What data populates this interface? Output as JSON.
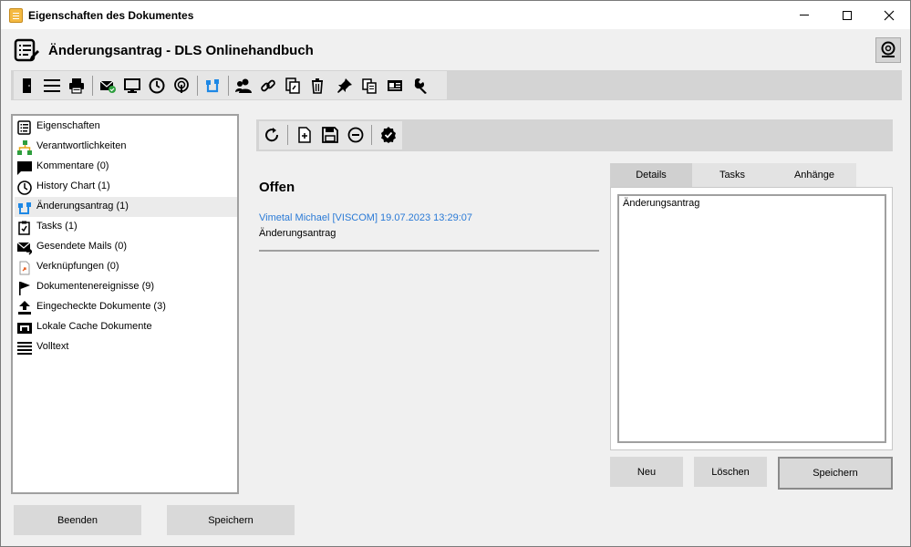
{
  "window": {
    "title": "Eigenschaften des Dokumentes"
  },
  "header": {
    "title": "Änderungsantrag - DLS Onlinehandbuch"
  },
  "main_toolbar": {
    "icons": [
      "door-icon",
      "menu-icon",
      "print-icon",
      "mail-check-icon",
      "monitor-icon",
      "clock-icon",
      "broadcast-icon",
      "workflow-icon",
      "users-icon",
      "link-icon",
      "copy-doc-icon",
      "trash-icon",
      "pin-icon",
      "copy-icon",
      "id-card-icon",
      "wrench-icon"
    ]
  },
  "nav": {
    "items": [
      {
        "label": "Eigenschaften",
        "icon": "properties-icon"
      },
      {
        "label": "Verantwortlichkeiten",
        "icon": "org-chart-icon"
      },
      {
        "label": "Kommentare (0)",
        "icon": "comment-icon"
      },
      {
        "label": "History Chart (1)",
        "icon": "clock-icon"
      },
      {
        "label": "Änderungsantrag (1)",
        "icon": "workflow-icon",
        "selected": true
      },
      {
        "label": "Tasks (1)",
        "icon": "task-icon"
      },
      {
        "label": "Gesendete Mails (0)",
        "icon": "mail-sent-icon"
      },
      {
        "label": "Verknüpfungen (0)",
        "icon": "shortcut-icon"
      },
      {
        "label": "Dokumentenereignisse (9)",
        "icon": "flag-icon"
      },
      {
        "label": "Eingecheckte Dokumente (3)",
        "icon": "upload-icon"
      },
      {
        "label": "Lokale Cache Dokumente",
        "icon": "cache-icon"
      },
      {
        "label": "Volltext",
        "icon": "lines-icon"
      }
    ]
  },
  "content": {
    "status_title": "Offen",
    "entry": {
      "author_line": "Vimetal Michael [VISCOM] 19.07.2023 13:29:07",
      "text": "Änderungsantrag"
    },
    "tabs": [
      {
        "label": "Details",
        "active": true
      },
      {
        "label": "Tasks"
      },
      {
        "label": "Anhänge"
      }
    ],
    "details_text": "Änderungsantrag",
    "buttons": {
      "new": "Neu",
      "delete": "Löschen",
      "save": "Speichern"
    }
  },
  "footer": {
    "close": "Beenden",
    "save": "Speichern"
  },
  "colors": {
    "link_blue": "#2a7ad6",
    "accent_blue": "#1e88e5",
    "toolbar_gray": "#d4d4d4"
  }
}
